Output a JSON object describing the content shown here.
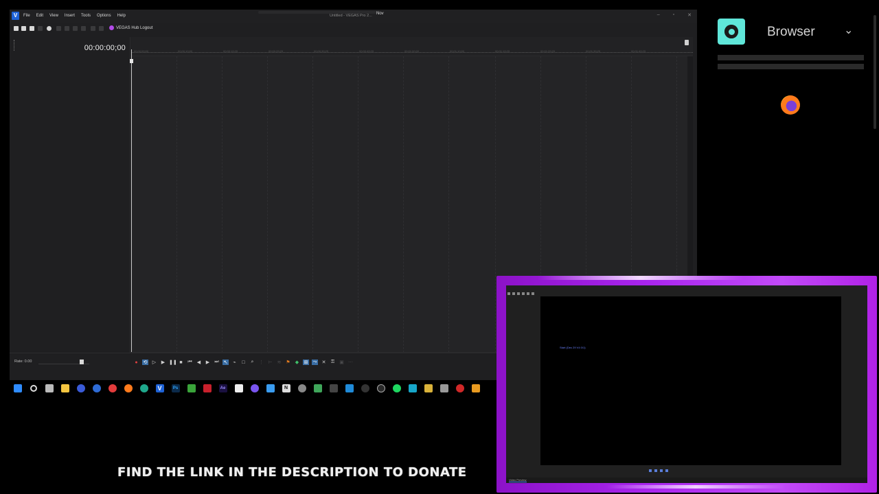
{
  "vegas": {
    "menu": [
      "File",
      "Edit",
      "View",
      "Insert",
      "Tools",
      "Options",
      "Help"
    ],
    "window_title": "Untitled - VEGAS Pro 2...",
    "title_tag": "Nov",
    "hub_label": "VEGAS Hub Logout",
    "timecode": "00:00:00;00",
    "rate_label": "Rate: 0.00",
    "ruler_ticks": [
      "00:00:00;00",
      "00:00:10;00",
      "00:00:19;29",
      "00:00:29;29",
      "00:00:39;29",
      "00:00:49;29",
      "00:01:00;00",
      "00:01:10;00",
      "00:01:19;29",
      "00:01:29;29",
      "00:01:39;29",
      "00:01:49;29"
    ]
  },
  "browser_panel": {
    "title": "Browser",
    "icon": "obs-record-icon",
    "browser_icon": "firefox-icon"
  },
  "overlay": {
    "chip": "Start (Dec 29 V4 0/1)",
    "tab": "Video Preview"
  },
  "caption": "FIND THE LINK IN THE DESCRIPTION TO DONATE",
  "colors": {
    "overlay_border": "#a925ee",
    "obs_accent": "#5fe6d9",
    "vegas_logo": "#1e62d6"
  }
}
